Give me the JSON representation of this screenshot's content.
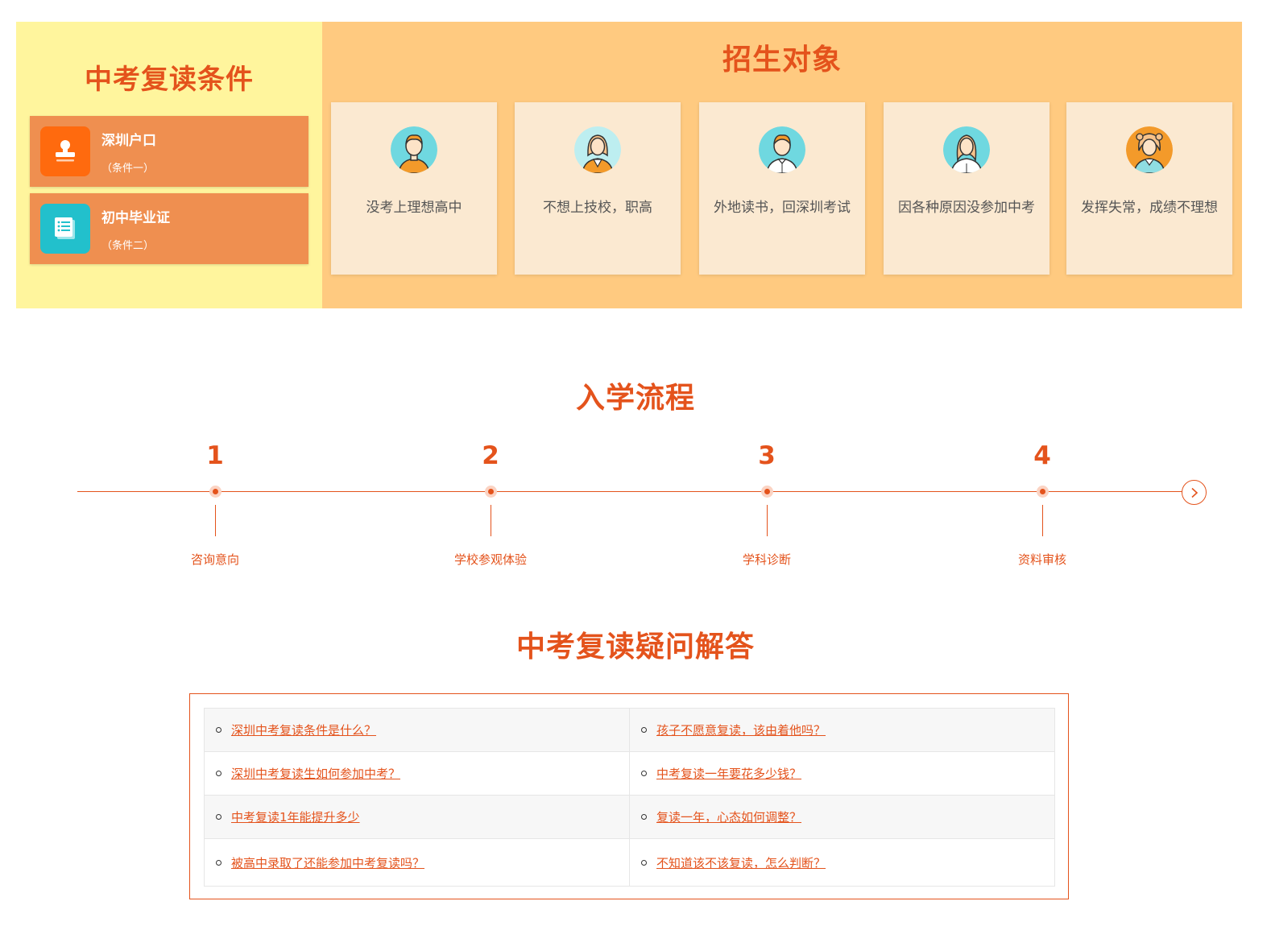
{
  "conditions": {
    "title": "中考复读条件",
    "items": [
      {
        "title": "深圳户口",
        "sub": "（条件一）",
        "icon": "stamp-icon"
      },
      {
        "title": "初中毕业证",
        "sub": "（条件二）",
        "icon": "certificate-icon"
      }
    ]
  },
  "targets": {
    "title": "招生对象",
    "items": [
      {
        "text": "没考上理想高中",
        "icon": "student-boy-avatar-icon"
      },
      {
        "text": "不想上技校，职高",
        "icon": "student-girl-avatar-icon"
      },
      {
        "text": "外地读书，回深圳考试",
        "icon": "student-boy-shirt-avatar-icon"
      },
      {
        "text": "因各种原因没参加中考",
        "icon": "student-girl-shirt-avatar-icon"
      },
      {
        "text": "发挥失常，成绩不理想",
        "icon": "student-girl-teal-avatar-icon"
      }
    ]
  },
  "process": {
    "title": "入学流程",
    "steps": [
      {
        "num": "1",
        "label": "咨询意向"
      },
      {
        "num": "2",
        "label": "学校参观体验"
      },
      {
        "num": "3",
        "label": "学科诊断"
      },
      {
        "num": "4",
        "label": "资料审核"
      }
    ]
  },
  "faq": {
    "title": "中考复读疑问解答",
    "rows": [
      [
        "深圳中考复读条件是什么？",
        "孩子不愿意复读，该由着他吗？"
      ],
      [
        "深圳中考复读生如何参加中考？",
        "中考复读一年要花多少钱？"
      ],
      [
        "中考复读1年能提升多少",
        "复读一年，心态如何调整？"
      ],
      [
        "被高中录取了还能参加中考复读吗？",
        "不知道该不该复读，怎么判断？"
      ]
    ]
  },
  "colors": {
    "accent": "#e4531c",
    "conditions_bg": "#fff59d",
    "targets_bg": "#ffca80",
    "card_bg": "#fbe9d1",
    "condition_card_bg": "#ef8f50"
  }
}
